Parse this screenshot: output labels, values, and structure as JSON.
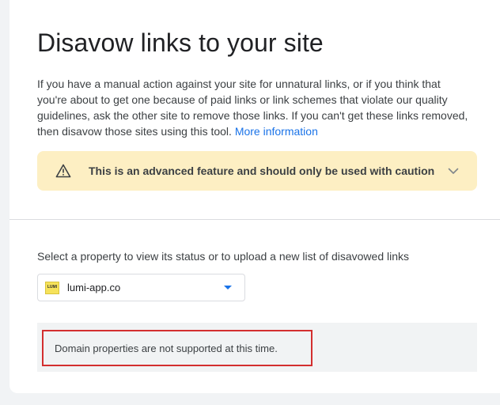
{
  "page": {
    "title": "Disavow links to your site",
    "intro_text": "If you have a manual action against your site for unnatural links, or if you think that you're about to get one because of paid links or link schemes that violate our quality guidelines, ask the other site to remove those links. If you can't get these links removed, then disavow those sites using this tool.",
    "more_info_link": "More information"
  },
  "warning": {
    "text": "This is an advanced feature and should only be used with caution",
    "icon": "warning-triangle-icon",
    "expand_icon": "chevron-down-icon",
    "background_color": "#fdefc3"
  },
  "property_section": {
    "label": "Select a property to view its status or to upload a new list of disavowed links",
    "selected_property": "lumi-app.co",
    "favicon_text": "LUMI",
    "favicon_color": "#f6e25a",
    "dropdown_icon": "caret-down-icon"
  },
  "status": {
    "message": "Domain properties are not supported at this time.",
    "highlight_color": "#d32f2f"
  },
  "colors": {
    "link": "#1a73e8",
    "text": "#3c4043"
  }
}
